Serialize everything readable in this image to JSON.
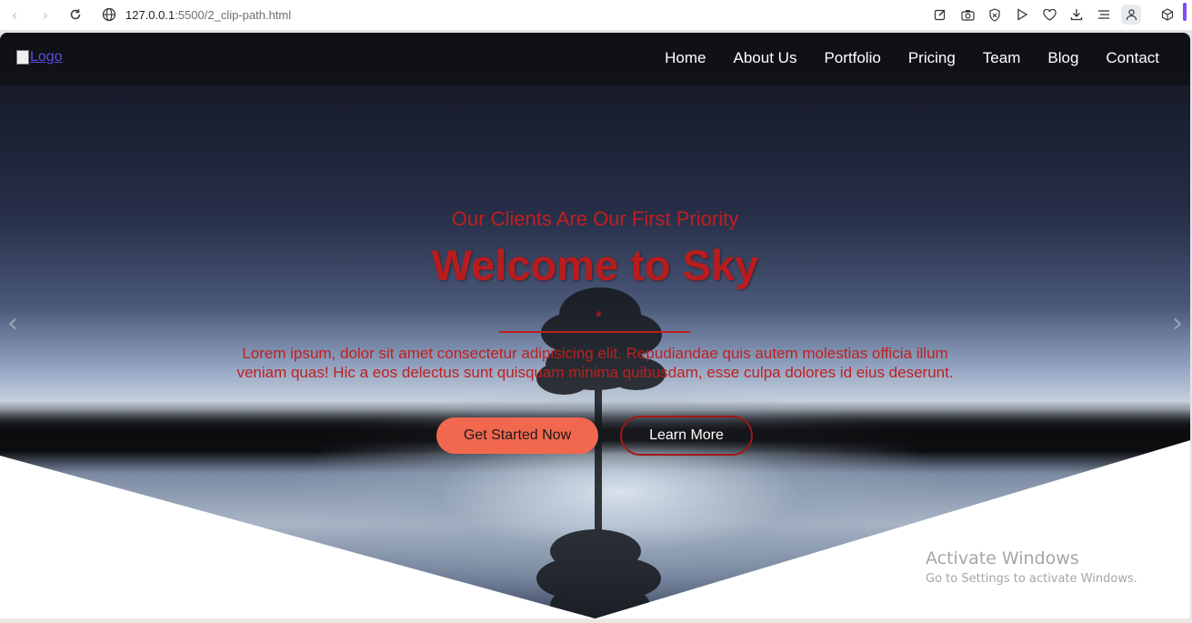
{
  "browser": {
    "url_host": "127.0.0.1",
    "url_path": ":5500/2_clip-path.html",
    "icons": [
      "back-icon",
      "forward-icon",
      "reload-icon",
      "globe-icon",
      "edit-icon",
      "camera-icon",
      "shield-icon",
      "play-icon",
      "heart-icon",
      "download-icon",
      "menu-icon",
      "profile-icon",
      "extensions-icon"
    ]
  },
  "header": {
    "logo_alt": "Logo",
    "menu": [
      "Home",
      "About Us",
      "Portfolio",
      "Pricing",
      "Team",
      "Blog",
      "Contact"
    ]
  },
  "hero": {
    "subtitle": "Our Clients Are Our First Priority",
    "title": "Welcome to Sky",
    "divider_symbol": "*",
    "description": "Lorem ipsum, dolor sit amet consectetur adipisicing elit. Repudiandae quis autem molestias officia illum veniam quas! Hic a eos delectus sunt quisquam minima quibusdam, esse culpa dolores id eius deserunt.",
    "primary_button": "Get Started Now",
    "secondary_button": "Learn More",
    "prev_arrow": "‹",
    "next_arrow": "›"
  },
  "watermark": {
    "title": "Activate Windows",
    "subtitle": "Go to Settings to activate Windows."
  },
  "colors": {
    "accent_red": "#c01f1f",
    "primary_button": "#f2684f",
    "header_bg": "#101116"
  }
}
